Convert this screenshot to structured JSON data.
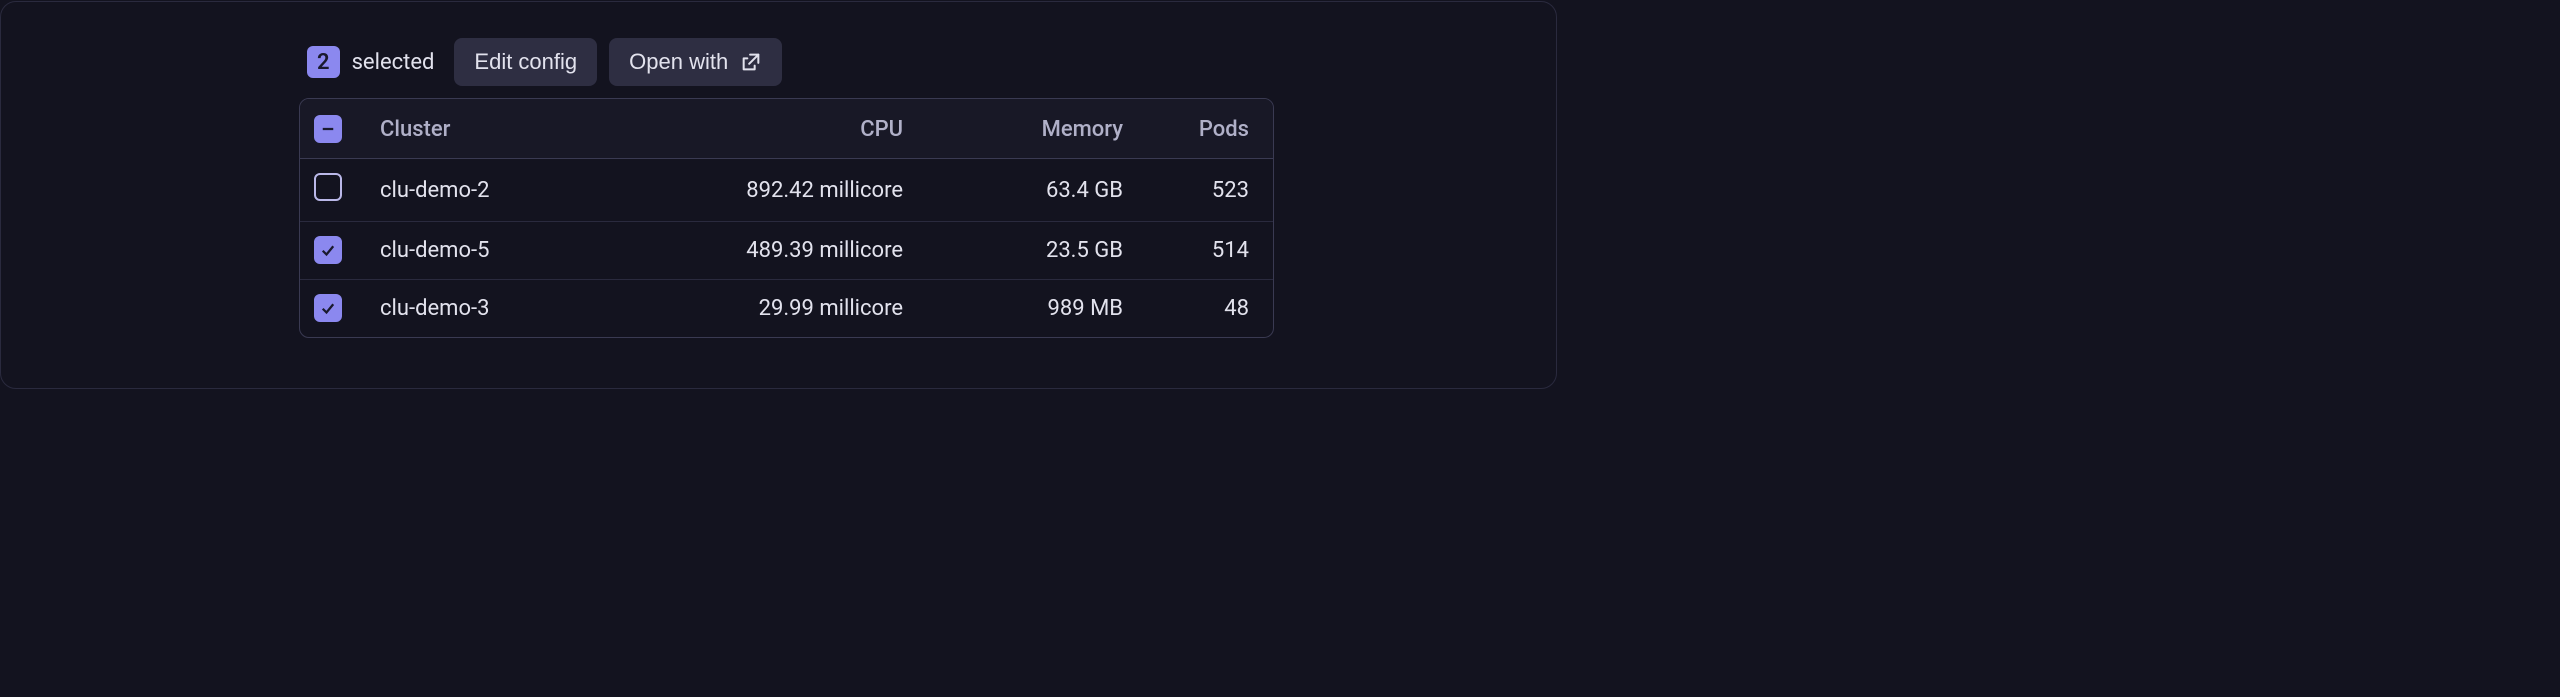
{
  "toolbar": {
    "count": "2",
    "selected_label": "selected",
    "edit_config_label": "Edit config",
    "open_with_label": "Open with"
  },
  "table": {
    "headers": {
      "cluster": "Cluster",
      "cpu": "CPU",
      "memory": "Memory",
      "pods": "Pods"
    },
    "rows": [
      {
        "checked": false,
        "cluster": "clu-demo-2",
        "cpu": "892.42 millicore",
        "memory": "63.4 GB",
        "pods": "523"
      },
      {
        "checked": true,
        "cluster": "clu-demo-5",
        "cpu": "489.39 millicore",
        "memory": "23.5 GB",
        "pods": "514"
      },
      {
        "checked": true,
        "cluster": "clu-demo-3",
        "cpu": "29.99 millicore",
        "memory": "989 MB",
        "pods": "48"
      }
    ]
  }
}
